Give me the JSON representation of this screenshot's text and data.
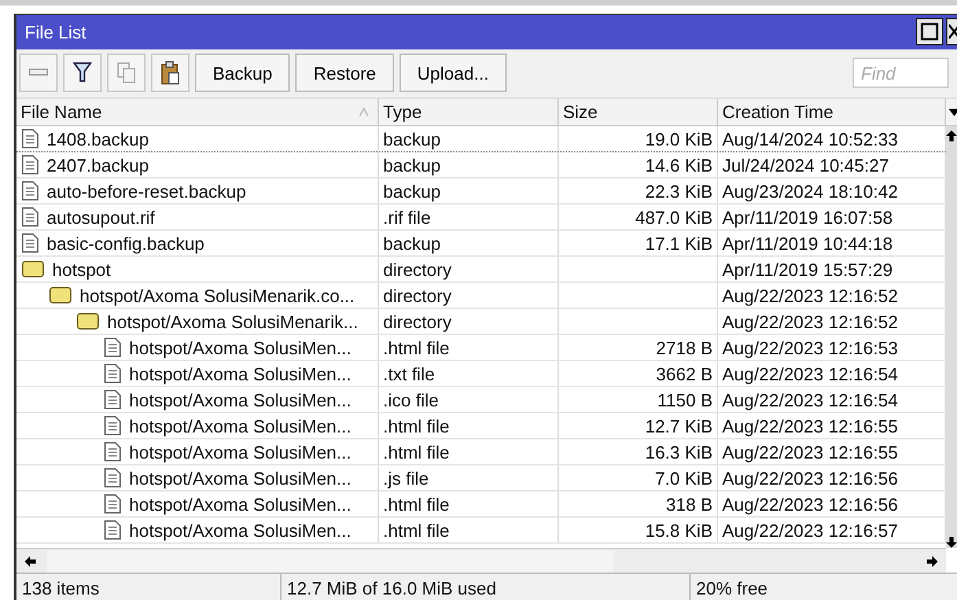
{
  "window": {
    "title": "File List"
  },
  "toolbar": {
    "buttons": [
      "Backup",
      "Restore",
      "Upload..."
    ],
    "search": {
      "placeholder": "Find"
    }
  },
  "table": {
    "columns": [
      "File Name",
      "Type",
      "Size",
      "Creation Time"
    ],
    "rows": [
      {
        "kind": "file",
        "name": "1408.backup",
        "type": "backup",
        "size": "19.0 KiB",
        "time": "Aug/14/2024 10:52:33"
      },
      {
        "kind": "file",
        "name": "2407.backup",
        "type": "backup",
        "size": "14.6 KiB",
        "time": "Jul/24/2024 10:45:27"
      },
      {
        "kind": "file",
        "name": "auto-before-reset.backup",
        "type": "backup",
        "size": "22.3 KiB",
        "time": "Aug/23/2024 18:10:42"
      },
      {
        "kind": "file",
        "name": "autosupout.rif",
        "type": ".rif file",
        "size": "487.0 KiB",
        "time": "Apr/11/2019 16:07:58"
      },
      {
        "kind": "file",
        "name": "basic-config.backup",
        "type": "backup",
        "size": "17.1 KiB",
        "time": "Apr/11/2019 10:44:18"
      },
      {
        "kind": "folder",
        "name": "hotspot",
        "type": "directory",
        "time": "Apr/11/2019 15:57:29",
        "children": [
          {
            "kind": "folder",
            "name": "hotspot/Axoma SolusiMenarik.co...",
            "type": "directory",
            "time": "Aug/22/2023 12:16:52",
            "children": [
              {
                "kind": "folder",
                "name": "hotspot/Axoma SolusiMenarik...",
                "type": "directory",
                "time": "Aug/22/2023 12:16:52",
                "children": [
                  {
                    "kind": "file",
                    "name": "hotspot/Axoma SolusiMen...",
                    "type": ".html file",
                    "size": "2718 B",
                    "time": "Aug/22/2023 12:16:53"
                  },
                  {
                    "kind": "file",
                    "name": "hotspot/Axoma SolusiMen...",
                    "type": ".txt file",
                    "size": "3662 B",
                    "time": "Aug/22/2023 12:16:54"
                  },
                  {
                    "kind": "file",
                    "name": "hotspot/Axoma SolusiMen...",
                    "type": ".ico file",
                    "size": "1150 B",
                    "time": "Aug/22/2023 12:16:54"
                  },
                  {
                    "kind": "file",
                    "name": "hotspot/Axoma SolusiMen...",
                    "type": ".html file",
                    "size": "12.7 KiB",
                    "time": "Aug/22/2023 12:16:55"
                  },
                  {
                    "kind": "file",
                    "name": "hotspot/Axoma SolusiMen...",
                    "type": ".html file",
                    "size": "16.3 KiB",
                    "time": "Aug/22/2023 12:16:55"
                  },
                  {
                    "kind": "file",
                    "name": "hotspot/Axoma SolusiMen...",
                    "type": ".js file",
                    "size": "7.0 KiB",
                    "time": "Aug/22/2023 12:16:56"
                  },
                  {
                    "kind": "file",
                    "name": "hotspot/Axoma SolusiMen...",
                    "type": ".html file",
                    "size": "318 B",
                    "time": "Aug/22/2023 12:16:56"
                  },
                  {
                    "kind": "file",
                    "name": "hotspot/Axoma SolusiMen...",
                    "type": ".html file",
                    "size": "15.8 KiB",
                    "time": "Aug/22/2023 12:16:57"
                  }
                ]
              }
            ]
          }
        ]
      }
    ]
  },
  "status_bar": [
    "138 items",
    "12.7 MiB of 16.0 MiB used",
    "20% free"
  ]
}
